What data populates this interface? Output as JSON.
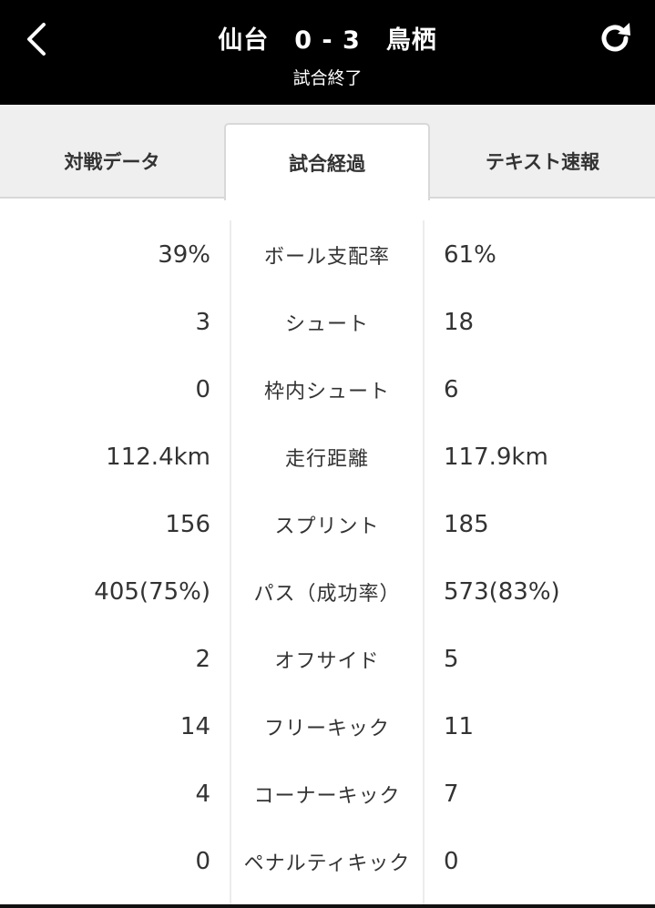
{
  "header": {
    "match_title": "仙台　0 - 3　鳥栖",
    "status": "試合終了",
    "back_icon": "chevron-left-icon",
    "refresh_icon": "refresh-icon"
  },
  "tabs": [
    {
      "label": "対戦データ",
      "active": false
    },
    {
      "label": "試合経過",
      "active": true
    },
    {
      "label": "テキスト速報",
      "active": false
    }
  ],
  "stats": [
    {
      "home": "39%",
      "label": "ボール支配率",
      "away": "61%"
    },
    {
      "home": "3",
      "label": "シュート",
      "away": "18"
    },
    {
      "home": "0",
      "label": "枠内シュート",
      "away": "6"
    },
    {
      "home": "112.4km",
      "label": "走行距離",
      "away": "117.9km"
    },
    {
      "home": "156",
      "label": "スプリント",
      "away": "185"
    },
    {
      "home": "405(75%)",
      "label": "パス（成功率）",
      "away": "573(83%)"
    },
    {
      "home": "2",
      "label": "オフサイド",
      "away": "5"
    },
    {
      "home": "14",
      "label": "フリーキック",
      "away": "11"
    },
    {
      "home": "4",
      "label": "コーナーキック",
      "away": "7"
    },
    {
      "home": "0",
      "label": "ペナルティキック",
      "away": "0"
    }
  ],
  "colors": {
    "header_bg": "#000000",
    "header_text": "#ffffff",
    "tab_bg": "#efefef",
    "active_tab_bg": "#ffffff",
    "text": "#333333"
  }
}
